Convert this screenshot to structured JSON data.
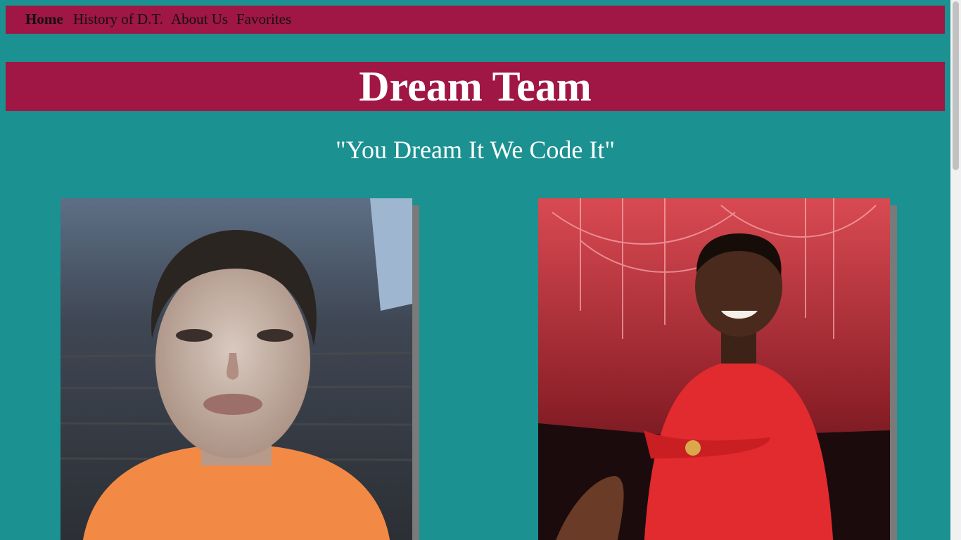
{
  "nav": {
    "items": [
      {
        "label": "Home",
        "active": true
      },
      {
        "label": "History of D.T."
      },
      {
        "label": "About Us"
      },
      {
        "label": "Favorites"
      }
    ]
  },
  "header": {
    "title": "Dream Team"
  },
  "tagline": "\"You Dream It We Code It\"",
  "colors": {
    "page_bg": "#1b9191",
    "accent": "#a01644",
    "text_light": "#ffffff"
  },
  "photos": [
    {
      "subject": "team-member-1-portrait"
    },
    {
      "subject": "team-member-2-portrait"
    }
  ]
}
